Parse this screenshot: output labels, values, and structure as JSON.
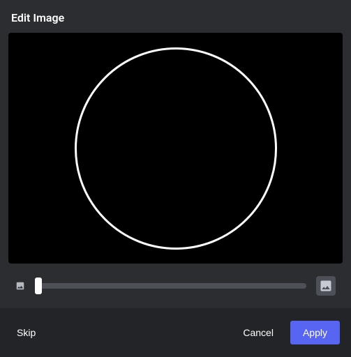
{
  "header": {
    "title": "Edit Image"
  },
  "zoom": {
    "small_icon": "image-small-icon",
    "large_icon": "image-large-icon",
    "value": 0,
    "min": 0,
    "max": 100
  },
  "footer": {
    "skip_label": "Skip",
    "cancel_label": "Cancel",
    "apply_label": "Apply"
  },
  "colors": {
    "accent": "#5865f2",
    "background": "#2b2d31",
    "footer_bg": "#232428",
    "preview_bg": "#1e1f22"
  }
}
